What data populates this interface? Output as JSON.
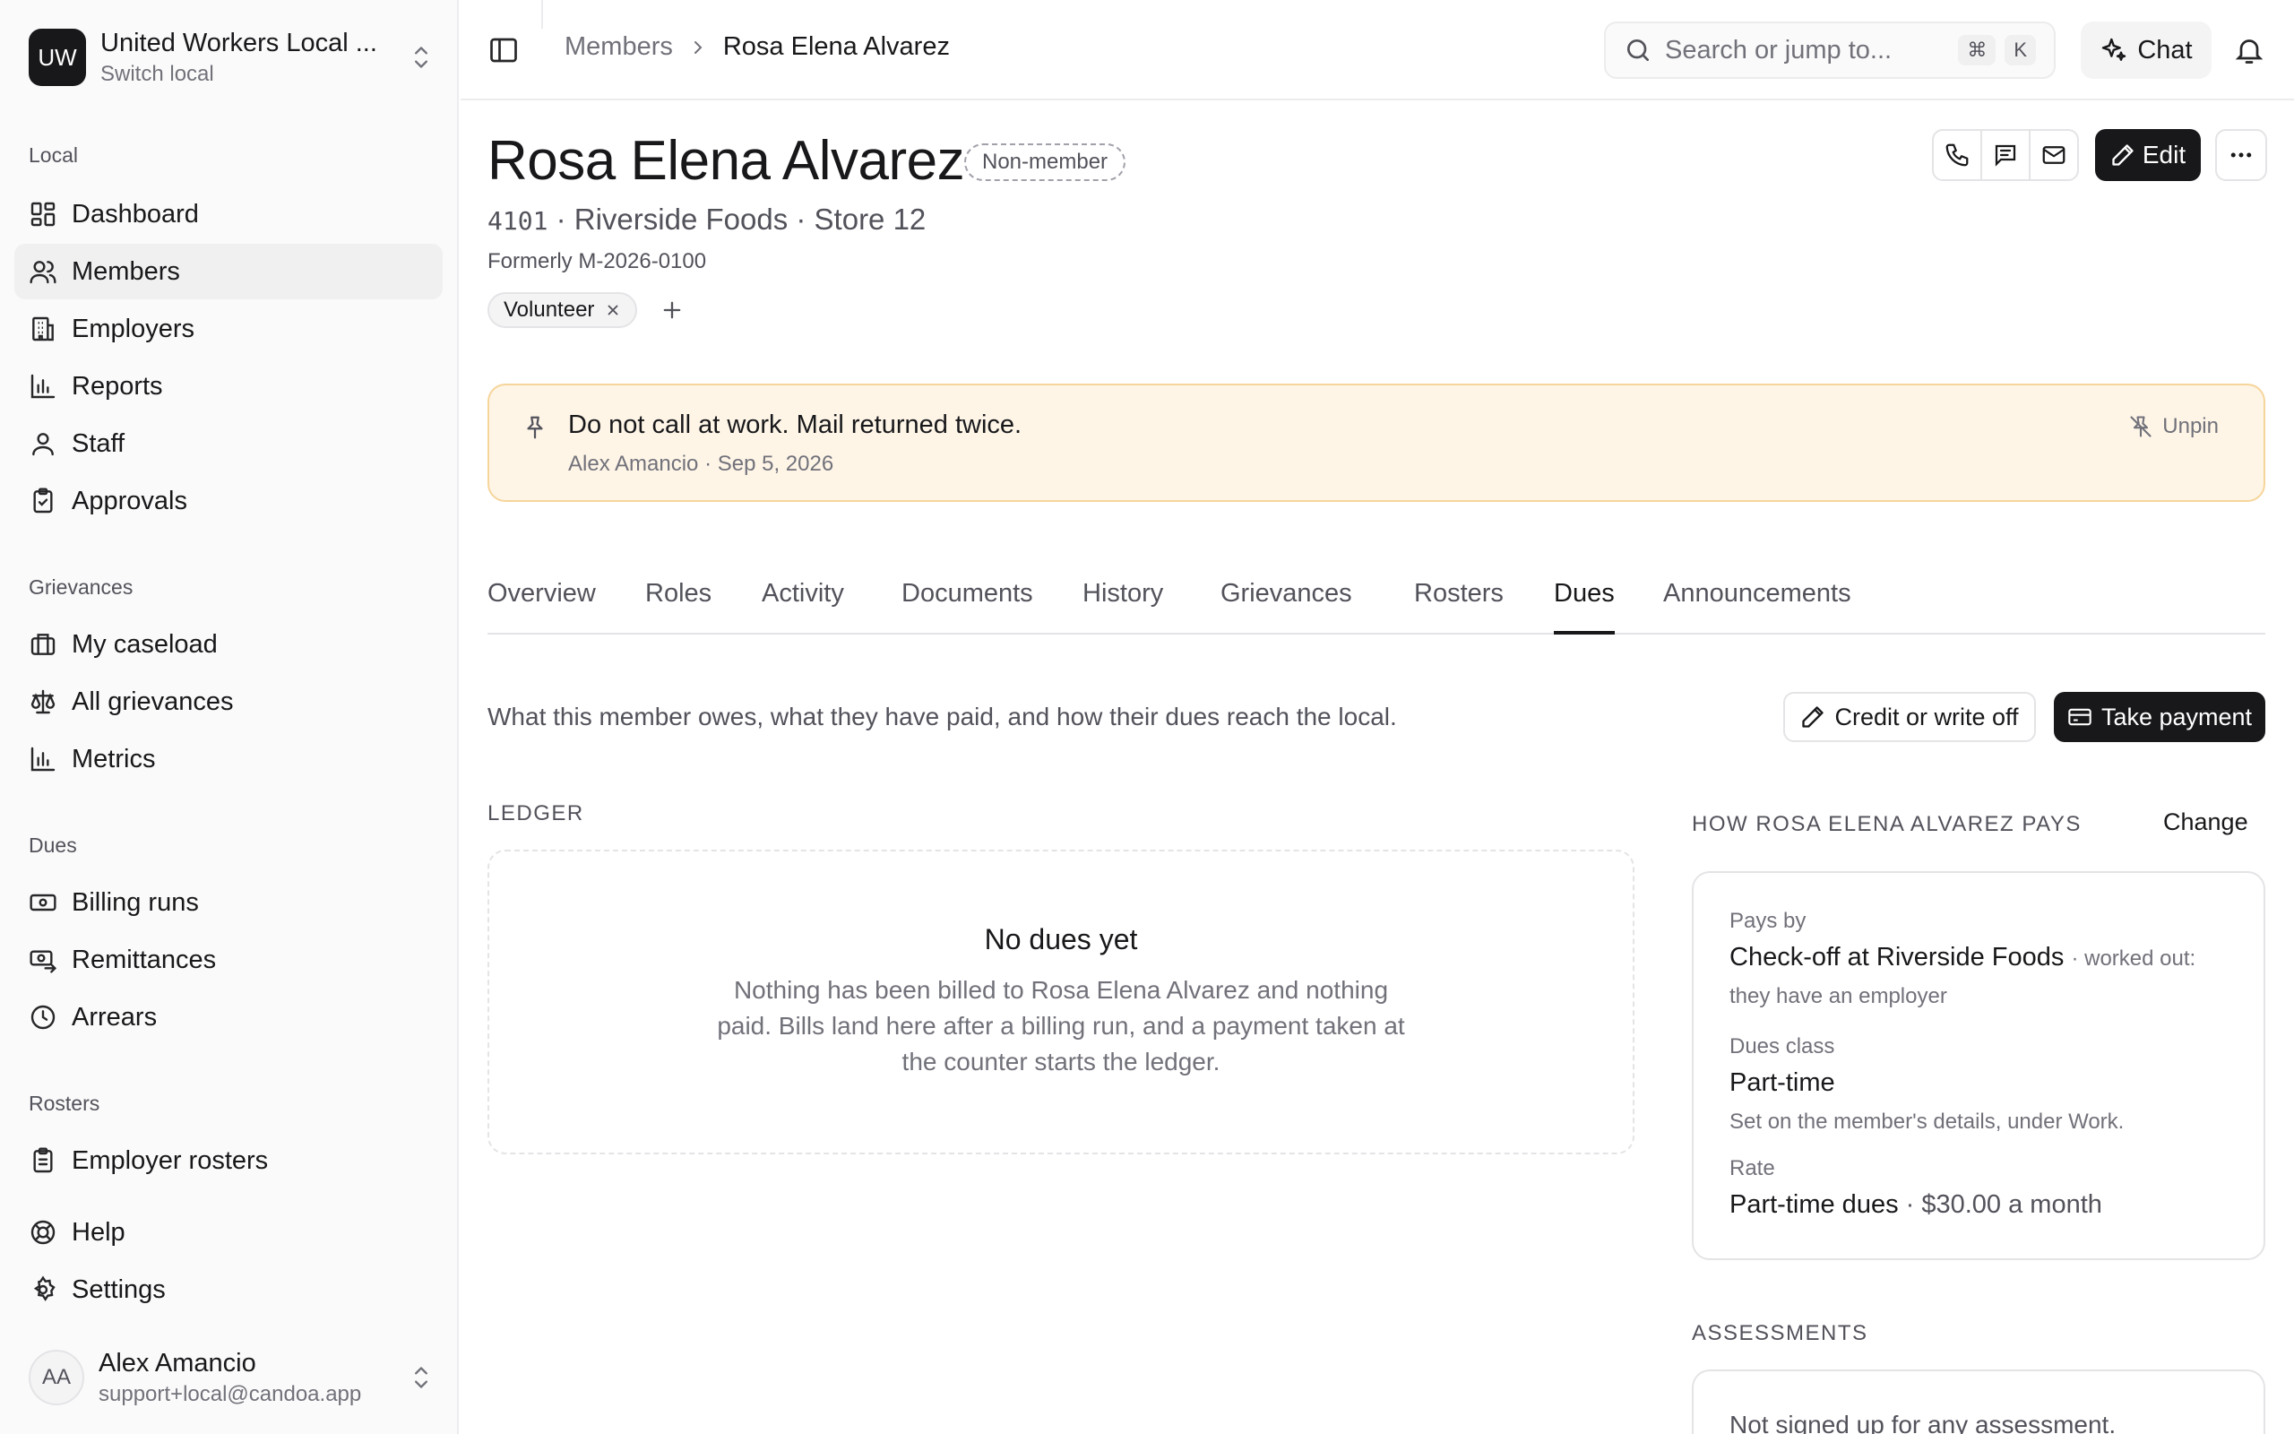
{
  "org": {
    "initials": "UW",
    "name": "United Workers Local ...",
    "sub": "Switch local"
  },
  "sections": {
    "local": "Local",
    "grievances": "Grievances",
    "dues": "Dues",
    "rosters": "Rosters"
  },
  "nav": {
    "dashboard": "Dashboard",
    "members": "Members",
    "employers": "Employers",
    "reports": "Reports",
    "staff": "Staff",
    "approvals": "Approvals",
    "caseload": "My caseload",
    "all_grievances": "All grievances",
    "metrics": "Metrics",
    "billing_runs": "Billing runs",
    "remittances": "Remittances",
    "arrears": "Arrears",
    "employer_rosters": "Employer rosters",
    "help": "Help",
    "settings": "Settings"
  },
  "user": {
    "initials": "AA",
    "name": "Alex Amancio",
    "email": "support+local@candoa.app"
  },
  "breadcrumb": {
    "parent": "Members",
    "current": "Rosa Elena Alvarez"
  },
  "search": {
    "placeholder": "Search or jump to...",
    "kbd1": "⌘",
    "kbd2": "K"
  },
  "chat_label": "Chat",
  "profile": {
    "name": "Rosa Elena Alvarez",
    "status": "Non-member",
    "number": "4101",
    "employer": "Riverside Foods",
    "unit": "Store 12",
    "formerly": "Formerly M-2026-0100",
    "tag": "Volunteer",
    "edit_label": "Edit"
  },
  "pinned": {
    "text": "Do not call at work. Mail returned twice.",
    "author": "Alex Amancio",
    "date": "Sep 5, 2026",
    "unpin": "Unpin"
  },
  "tabs": [
    "Overview",
    "Roles",
    "Activity",
    "Documents",
    "History",
    "Grievances",
    "Rosters",
    "Dues",
    "Announcements"
  ],
  "dues": {
    "description": "What this member owes, what they have paid, and how their dues reach the local.",
    "credit_label": "Credit or write off",
    "pay_label": "Take payment",
    "ledger_label": "LEDGER",
    "empty_title": "No dues yet",
    "empty_body": "Nothing has been billed to Rosa Elena Alvarez and nothing paid. Bills land here after a billing run, and a payment taken at the counter starts the ledger.",
    "pays_label": "HOW ROSA ELENA ALVAREZ PAYS",
    "change": "Change",
    "pays_by_label": "Pays by",
    "pays_by": "Check-off at Riverside Foods",
    "pays_by_note": "· worked out:",
    "pays_by_note2": "they have an employer",
    "class_label": "Dues class",
    "class": "Part-time",
    "class_note": "Set on the member's details, under Work.",
    "rate_label": "Rate",
    "rate_name": "Part-time dues",
    "rate_amount": "· $30.00 a month",
    "assess_label": "ASSESSMENTS",
    "assess_text": "Not signed up for any assessment."
  }
}
